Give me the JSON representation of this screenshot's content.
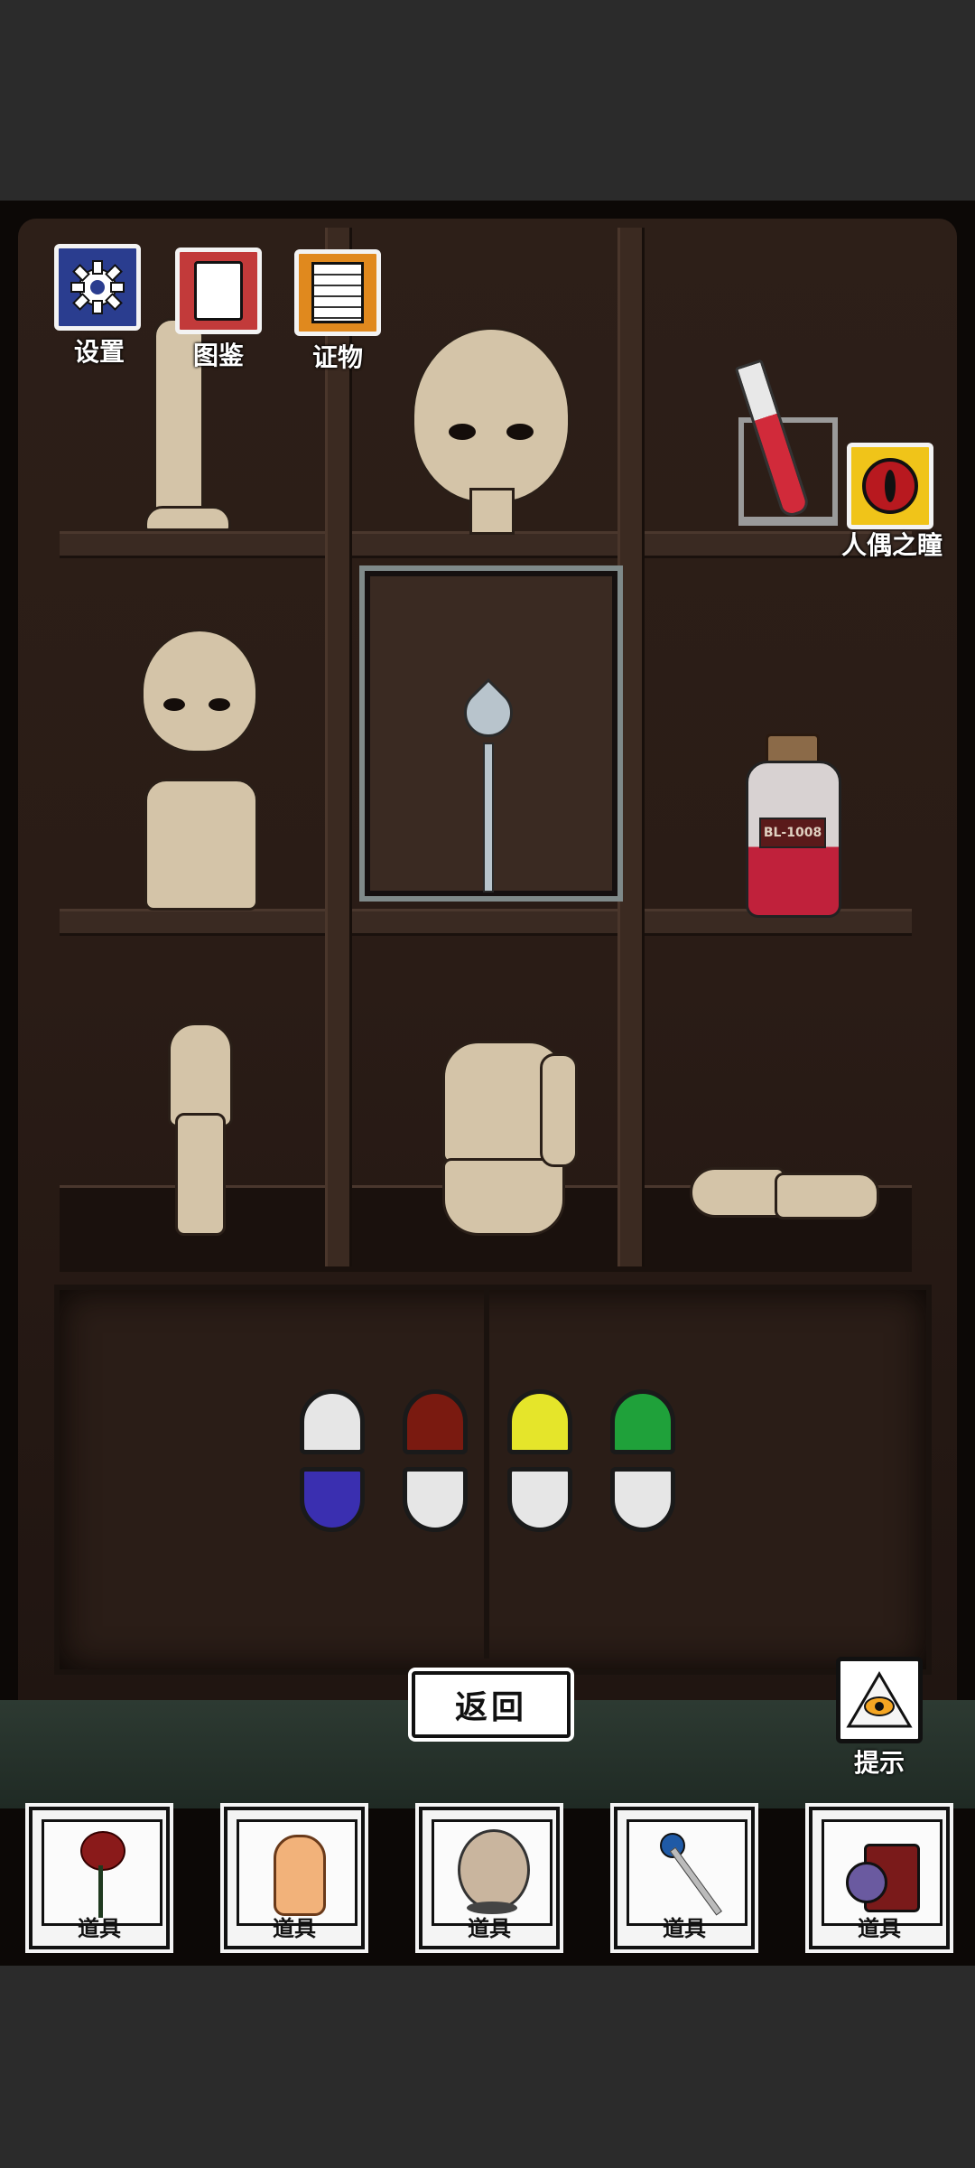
{
  "hud": {
    "settings_label": "设置",
    "encyclopedia_label": "图鉴",
    "evidence_label": "证物",
    "doll_eye_label": "人偶之瞳",
    "hint_label": "提示"
  },
  "scene": {
    "bottle_label": "BL-1008",
    "pill_colors": {
      "top": [
        "#e6e6e6",
        "#7a1a10",
        "#e5e52a",
        "#1fa13a"
      ],
      "bottom": [
        "#3a2fb0",
        "#e6e6e6",
        "#e6e6e6",
        "#e6e6e6"
      ]
    }
  },
  "back_button_label": "返回",
  "inventory": [
    {
      "item": "rose",
      "label": "道具"
    },
    {
      "item": "palm-hand",
      "label": "道具"
    },
    {
      "item": "doll-head",
      "label": "道具"
    },
    {
      "item": "dropper-pin",
      "label": "道具"
    },
    {
      "item": "lantern",
      "label": "道具"
    }
  ],
  "icons": {
    "settings": "gear-icon",
    "encyclopedia": "book-icon",
    "evidence": "notepad-icon",
    "doll_eye": "eye-icon",
    "hint": "eye-pyramid-icon"
  }
}
